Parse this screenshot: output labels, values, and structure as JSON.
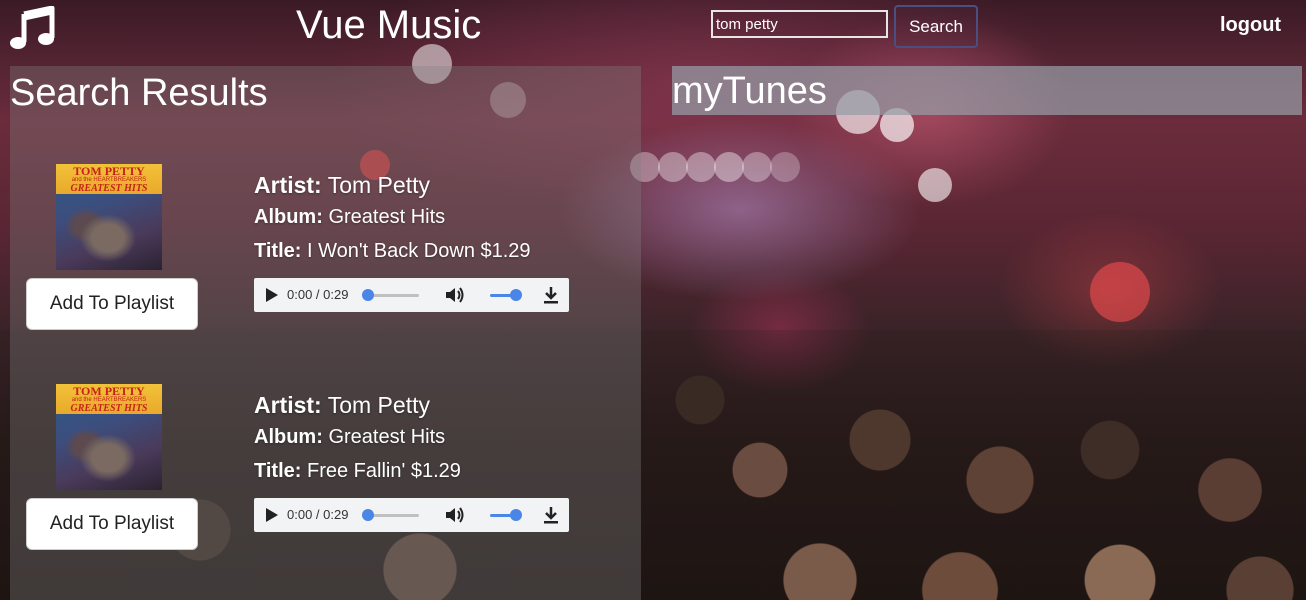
{
  "header": {
    "app_icon": "music-note-icon",
    "title": "Vue Music",
    "search": {
      "value": "tom petty",
      "placeholder": ""
    },
    "search_button_label": "Search",
    "logout_label": "logout"
  },
  "results": {
    "heading": "Search Results",
    "songs": [
      {
        "artist_label": "Artist:",
        "artist": "Tom Petty",
        "album_label": "Album:",
        "album": "Greatest Hits",
        "title_label": "Title:",
        "title": "I Won't Back Down $1.29",
        "add_button_label": "Add To Playlist",
        "player_time": "0:00 / 0:29",
        "art": {
          "line1": "TOM PETTY",
          "line2": "and the HEARTBREAKERS",
          "line3": "GREATEST HITS"
        }
      },
      {
        "artist_label": "Artist:",
        "artist": "Tom Petty",
        "album_label": "Album:",
        "album": "Greatest Hits",
        "title_label": "Title:",
        "title": "Free Fallin' $1.29",
        "add_button_label": "Add To Playlist",
        "player_time": "0:00 / 0:29",
        "art": {
          "line1": "TOM PETTY",
          "line2": "and the HEARTBREAKERS",
          "line3": "GREATEST HITS"
        }
      }
    ]
  },
  "mytunes": {
    "heading": "myTunes"
  },
  "icons": {
    "play": "play-icon",
    "volume": "volume-icon",
    "download": "download-icon"
  },
  "colors": {
    "accent": "#4a86e8",
    "panel": "#808080",
    "text": "#ffffff"
  }
}
